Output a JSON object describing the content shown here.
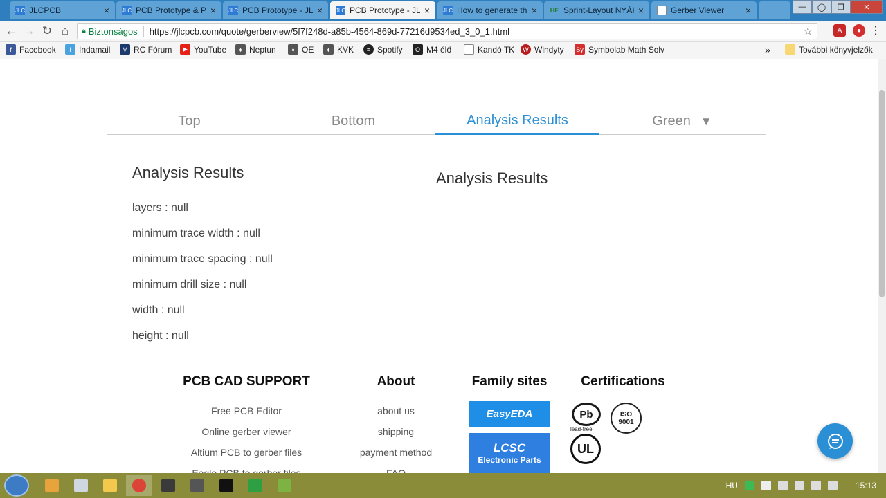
{
  "browser": {
    "tabs": [
      {
        "label": "JLCPCB",
        "fav": "JLC"
      },
      {
        "label": "PCB Prototype & PC",
        "fav": "JLC"
      },
      {
        "label": "PCB Prototype - JLC",
        "fav": "JLC"
      },
      {
        "label": "PCB Prototype - JLC",
        "fav": "JLC"
      },
      {
        "label": "How to generate the",
        "fav": "JLC"
      },
      {
        "label": "Sprint-Layout NYÁK",
        "fav": "HE"
      },
      {
        "label": "Gerber Viewer",
        "fav": ""
      }
    ],
    "active_tab_index": 3,
    "secure_label": "Biztonságos",
    "url": "https://jlcpcb.com/quote/gerberview/5f7f248d-a85b-4564-869d-77216d9534ed_3_0_1.html",
    "bookmarks": [
      {
        "label": "Facebook",
        "color": "#3b5998",
        "glyph": "f"
      },
      {
        "label": "Indamail",
        "color": "#4aa3df",
        "glyph": "i"
      },
      {
        "label": "RC Fórum",
        "color": "#1b3a6b",
        "glyph": "V"
      },
      {
        "label": "YouTube",
        "color": "#e62117",
        "glyph": "▶"
      },
      {
        "label": "Neptun",
        "color": "#555555",
        "glyph": "♦"
      },
      {
        "label": "OE",
        "color": "#555555",
        "glyph": "♦"
      },
      {
        "label": "KVK",
        "color": "#555555",
        "glyph": "♦"
      },
      {
        "label": "Spotify",
        "color": "#222222",
        "glyph": "≡"
      },
      {
        "label": "M4 élő",
        "color": "#222222",
        "glyph": "O"
      },
      {
        "label": "Kandó TK",
        "color": "#ffffff",
        "glyph": ""
      },
      {
        "label": "Windyty",
        "color": "#b71c1c",
        "glyph": "W"
      },
      {
        "label": "Symbolab Math Solv",
        "color": "#d32f2f",
        "glyph": "Sy"
      }
    ],
    "more_bookmarks_label": "»",
    "other_bookmarks_label": "További könyvjelzők"
  },
  "viewer": {
    "tabs": [
      "Top",
      "Bottom",
      "Analysis Results",
      "Green"
    ],
    "active_tab": "Analysis Results",
    "caret": "▼"
  },
  "analysis": {
    "left_title": "Analysis Results",
    "right_title": "Analysis Results",
    "rows": [
      "layers : null",
      "minimum trace width : null",
      "minimum trace spacing : null",
      "minimum drill size : null",
      "width : null",
      "height : null"
    ]
  },
  "footer": {
    "pcb_cad": {
      "title": "PCB CAD SUPPORT",
      "links": [
        "Free PCB Editor",
        "Online gerber viewer",
        "Altium PCB to gerber files",
        "Eagle PCB to gerber files"
      ]
    },
    "about": {
      "title": "About",
      "links": [
        "about us",
        "shipping",
        "payment method",
        "FAQ"
      ]
    },
    "family": {
      "title": "Family sites",
      "easyeda": "EasyEDA",
      "lcsc": "LCSC",
      "lcsc_sub": "Electronic Parts"
    },
    "certifications": {
      "title": "Certifications",
      "pb": "Pb",
      "pb_sub": "lead-free",
      "iso": "ISO 9001",
      "ul": "UL"
    }
  },
  "taskbar": {
    "language": "HU",
    "time": "15:13"
  },
  "colors": {
    "accent": "#2b8fd6",
    "chrome_blue": "#2f7fbf"
  }
}
